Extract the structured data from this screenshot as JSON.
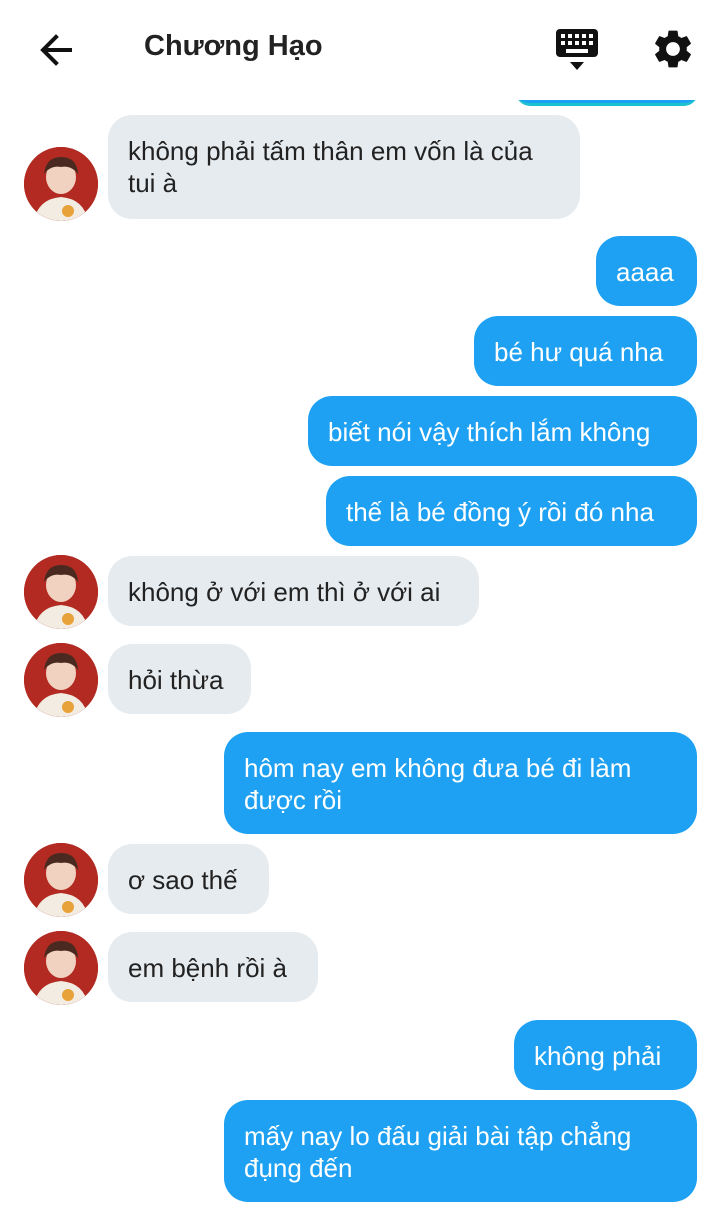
{
  "header": {
    "title": "Chương Hạo",
    "back_icon": "arrow-left-icon",
    "keyboard_icon": "keyboard-icon",
    "settings_icon": "gear-icon"
  },
  "colors": {
    "outgoing_bubble": "#1ea1f2",
    "incoming_bubble": "#e6ebef",
    "avatar_bg": "#b22a22"
  },
  "messages": [
    {
      "side": "in",
      "text": "không phải tấm thân em vốn là của tui à"
    },
    {
      "side": "out",
      "text": "aaaa"
    },
    {
      "side": "out",
      "text": "bé hư quá nha"
    },
    {
      "side": "out",
      "text": "biết nói vậy thích lắm không"
    },
    {
      "side": "out",
      "text": "thế là bé đồng ý rồi đó nha"
    },
    {
      "side": "in",
      "text": "không ở với em thì ở với ai"
    },
    {
      "side": "in",
      "text": "hỏi thừa"
    },
    {
      "side": "out",
      "text": "hôm nay em không đưa bé đi làm được rồi"
    },
    {
      "side": "in",
      "text": "ơ sao thế"
    },
    {
      "side": "in",
      "text": "em bệnh rồi à"
    },
    {
      "side": "out",
      "text": "không phải"
    },
    {
      "side": "out",
      "text": "mấy nay lo đấu giải bài tập chẳng đụng đến"
    }
  ]
}
